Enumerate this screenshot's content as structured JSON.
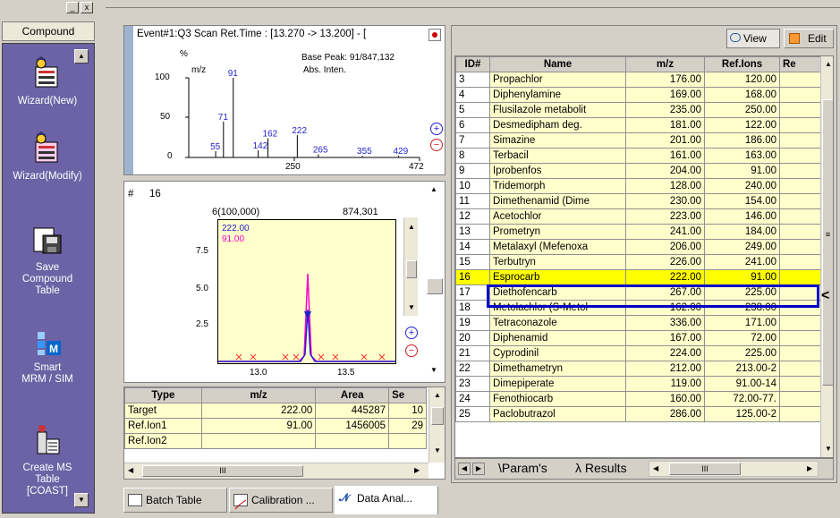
{
  "sidebar": {
    "tab_label": "Compound",
    "items": [
      {
        "label": "Wizard(New)",
        "icon": "wizard-new-icon"
      },
      {
        "label": "Wizard(Modify)",
        "icon": "wizard-modify-icon"
      },
      {
        "label": "Save\nCompound\nTable",
        "icon": "save-compound-table-icon"
      },
      {
        "label": "Smart\nMRM / SIM",
        "icon": "smart-mrm-sim-icon"
      },
      {
        "label": "Create MS\nTable\n[COAST]",
        "icon": "create-ms-table-icon"
      }
    ],
    "window_buttons": [
      "_",
      "x"
    ]
  },
  "spectrum": {
    "header": "Event#1:Q3 Scan  Ret.Time : [13.270 -> 13.200] - [",
    "base_peak": "Base Peak: 91/847,132",
    "y_unit": "%",
    "mz_label": "m/z",
    "abs_label": "Abs. Inten.",
    "yticks": [
      "100",
      "50",
      "0"
    ],
    "xticks": [
      "250",
      "472"
    ],
    "peaks": [
      {
        "label": "55",
        "mz": 55,
        "pct": 8
      },
      {
        "label": "71",
        "mz": 71,
        "pct": 45
      },
      {
        "label": "91",
        "mz": 91,
        "pct": 100
      },
      {
        "label": "142",
        "mz": 142,
        "pct": 9
      },
      {
        "label": "162",
        "mz": 162,
        "pct": 24
      },
      {
        "label": "222",
        "mz": 222,
        "pct": 28
      },
      {
        "label": "265",
        "mz": 265,
        "pct": 4
      },
      {
        "label": "355",
        "mz": 355,
        "pct": 2
      },
      {
        "label": "429",
        "mz": 429,
        "pct": 2
      }
    ]
  },
  "chromatogram": {
    "id_label": "#",
    "id_value": "16",
    "scale_label": "6(100,000)",
    "intensity": "874,301",
    "trace1_label": "222.00",
    "trace2_label": "91.00",
    "yticks": [
      "7.5",
      "5.0",
      "2.5"
    ],
    "xticks": [
      "13.0",
      "13.5"
    ]
  },
  "ion_table": {
    "headers": [
      "Type",
      "m/z",
      "Area",
      "Se"
    ],
    "rows": [
      [
        "Target",
        "222.00",
        "445287",
        "10"
      ],
      [
        "Ref.Ion1",
        "91.00",
        "1456005",
        "29"
      ],
      [
        "Ref.Ion2",
        "",
        "",
        ""
      ]
    ],
    "scroll_label": "III"
  },
  "compound_table": {
    "view_button": "View",
    "edit_button": "Edit",
    "headers": [
      "ID#",
      "Name",
      "m/z",
      "Ref.Ions",
      "Re"
    ],
    "rows": [
      [
        "3",
        "Propachlor",
        "176.00",
        "120.00"
      ],
      [
        "4",
        "Diphenylamine",
        "169.00",
        "168.00"
      ],
      [
        "5",
        "Flusilazole metabolit",
        "235.00",
        "250.00"
      ],
      [
        "6",
        "Desmedipham deg.",
        "181.00",
        "122.00"
      ],
      [
        "7",
        "Simazine",
        "201.00",
        "186.00"
      ],
      [
        "8",
        "Terbacil",
        "161.00",
        "163.00"
      ],
      [
        "9",
        "Iprobenfos",
        "204.00",
        "91.00"
      ],
      [
        "10",
        "Tridemorph",
        "128.00",
        "240.00"
      ],
      [
        "11",
        "Dimethenamid (Dime",
        "230.00",
        "154.00"
      ],
      [
        "12",
        "Acetochlor",
        "223.00",
        "146.00"
      ],
      [
        "13",
        "Prometryn",
        "241.00",
        "184.00"
      ],
      [
        "14",
        "Metalaxyl (Mefenoxa",
        "206.00",
        "249.00"
      ],
      [
        "15",
        "Terbutryn",
        "226.00",
        "241.00"
      ],
      [
        "16",
        "Esprocarb",
        "222.00",
        "91.00"
      ],
      [
        "17",
        "Diethofencarb",
        "267.00",
        "225.00"
      ],
      [
        "18",
        "Metolachlor (S-Metol",
        "162.00",
        "238.00"
      ],
      [
        "19",
        "Tetraconazole",
        "336.00",
        "171.00"
      ],
      [
        "20",
        "Diphenamid",
        "167.00",
        "72.00"
      ],
      [
        "21",
        "Cyprodinil",
        "224.00",
        "225.00"
      ],
      [
        "22",
        "Dimethametryn",
        "212.00",
        "213.00-2"
      ],
      [
        "23",
        "Dimepiperate",
        "119.00",
        "91.00-14"
      ],
      [
        "24",
        "Fenothiocarb",
        "160.00",
        "72.00-77."
      ],
      [
        "25",
        "Paclobutrazol",
        "286.00",
        "125.00-2"
      ]
    ],
    "selected_id": "16",
    "tabs": [
      "Param's",
      "Results"
    ],
    "scroll_label": "III"
  },
  "bottom_tabs": [
    "Batch Table",
    "Calibration ...",
    "Data Anal..."
  ],
  "colors": {
    "sidebar_bg": "#6b63a5",
    "highlight": "#ffff00",
    "selection_border": "#0000cc",
    "trace_pink": "#ff00cc",
    "trace_blue": "#2222cc",
    "peak_label_blue": "#2222cc"
  }
}
